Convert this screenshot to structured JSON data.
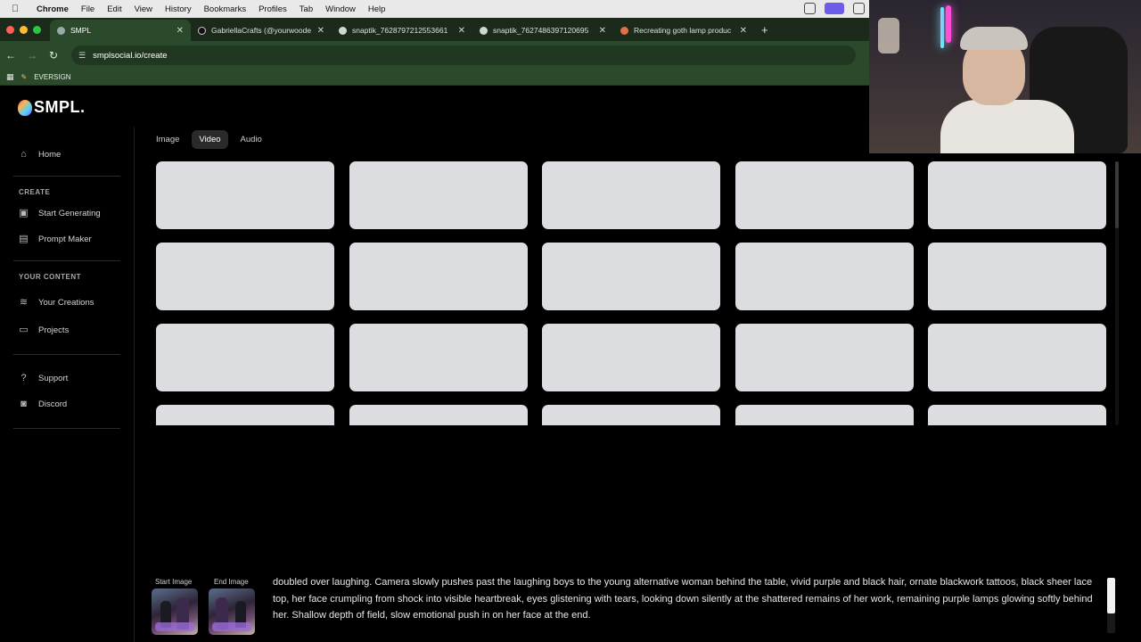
{
  "menubar": {
    "app": "Chrome",
    "items": [
      "File",
      "Edit",
      "View",
      "History",
      "Bookmarks",
      "Profiles",
      "Tab",
      "Window",
      "Help"
    ]
  },
  "tabs": [
    {
      "title": "SMPL",
      "active": true
    },
    {
      "title": "GabriellaCrafts (@yourwoode",
      "active": false
    },
    {
      "title": "snaptik_7628797212553661",
      "active": false
    },
    {
      "title": "snaptik_7627486397120695",
      "active": false
    },
    {
      "title": "Recreating goth lamp produc",
      "active": false
    }
  ],
  "toolbar": {
    "url": "smplsocial.io/create"
  },
  "bookmarks": {
    "item": "EVERSIGN"
  },
  "app": {
    "logo": "SMPL.",
    "sidebar": {
      "home": "Home",
      "create_heading": "CREATE",
      "start_generating": "Start Generating",
      "prompt_maker": "Prompt Maker",
      "content_heading": "YOUR CONTENT",
      "your_creations": "Your Creations",
      "projects": "Projects",
      "support": "Support",
      "discord": "Discord"
    },
    "media_tabs": {
      "image": "Image",
      "video": "Video",
      "audio": "Audio",
      "active": "Video"
    },
    "grid": {
      "rows": 4,
      "cols": 5
    },
    "prompt": {
      "start_image_label": "Start Image",
      "end_image_label": "End Image",
      "text": "doubled over laughing. Camera slowly pushes past the laughing boys to the young alternative woman behind the table, vivid purple and black hair, ornate blackwork tattoos, black sheer lace top, her face crumpling from shock into visible heartbreak, eyes glistening with tears, looking down silently at the shattered remains of her work, remaining purple lamps glowing softly behind her. Shallow depth of field, slow emotional push in on her face at the end."
    }
  },
  "colors": {
    "chrome_green": "#2b4a2b",
    "card": "#dcdde1",
    "background": "#000000"
  }
}
